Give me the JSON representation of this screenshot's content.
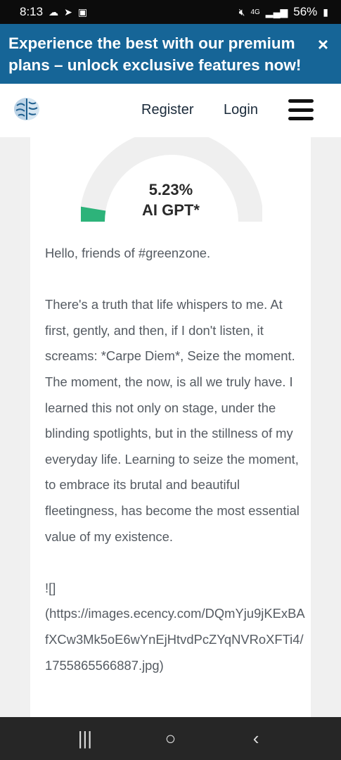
{
  "status_bar": {
    "time": "8:13",
    "left_icons": [
      "cloud-icon",
      "telegram-icon",
      "gallery-icon"
    ],
    "network": "4G",
    "battery": "56%"
  },
  "banner": {
    "text": "Experience the best with our premium plans – unlock exclusive features now!",
    "close": "×"
  },
  "nav": {
    "register": "Register",
    "login": "Login"
  },
  "gauge": {
    "percent": "5.23%",
    "label": "AI GPT*",
    "value": 0.0523,
    "fill_color": "#2db37a",
    "track_color": "#efefef"
  },
  "post": {
    "paragraphs": [
      "Hello, friends of #greenzone.",
      "There's a truth that life whispers to me. At first, gently, and then, if I don't listen, it screams: *Carpe Diem*, Seize the moment.\nThe moment, the now, is all we truly have. I learned this not only on stage, under the blinding spotlights, but in the stillness of my everyday life. Learning to seize the moment, to embrace its brutal and beautiful fleetingness, has become the most essential value of my existence.",
      "![]\n(https://images.ecency.com/DQmYju9jKExBAfXCw3Mk5oE6wYnEjHtvdPcZYqNVRoXFTi4/1755865566887.jpg)"
    ]
  },
  "bottom_bar": {
    "recent": "|||",
    "home": "○",
    "back": "‹"
  }
}
